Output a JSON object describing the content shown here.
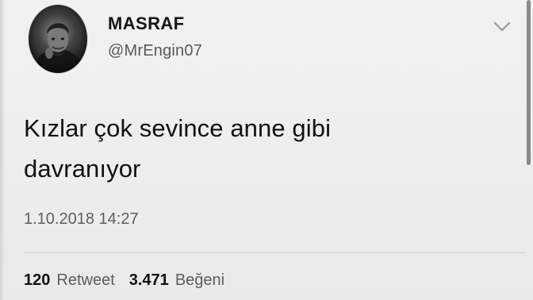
{
  "tweet": {
    "author": {
      "display_name": "MASRAF",
      "handle": "@MrEngin07"
    },
    "text_lines": [
      "Kızlar çok sevince anne gibi",
      "davranıyor"
    ],
    "timestamp": "1.10.2018 14:27",
    "stats": {
      "retweets": {
        "count": "120",
        "label": "Retweet"
      },
      "likes": {
        "count": "3.471",
        "label": "Beğeni"
      }
    }
  },
  "icons": {
    "menu": "chevron-down-icon",
    "avatar": "avatar"
  },
  "colors": {
    "background": "#ececec",
    "text_primary": "#151515",
    "text_secondary": "#5c5c5c",
    "divider": "#cdcdcd"
  },
  "scrollbar": {
    "position_fraction": 0.0,
    "visible_fraction": 0.55
  }
}
